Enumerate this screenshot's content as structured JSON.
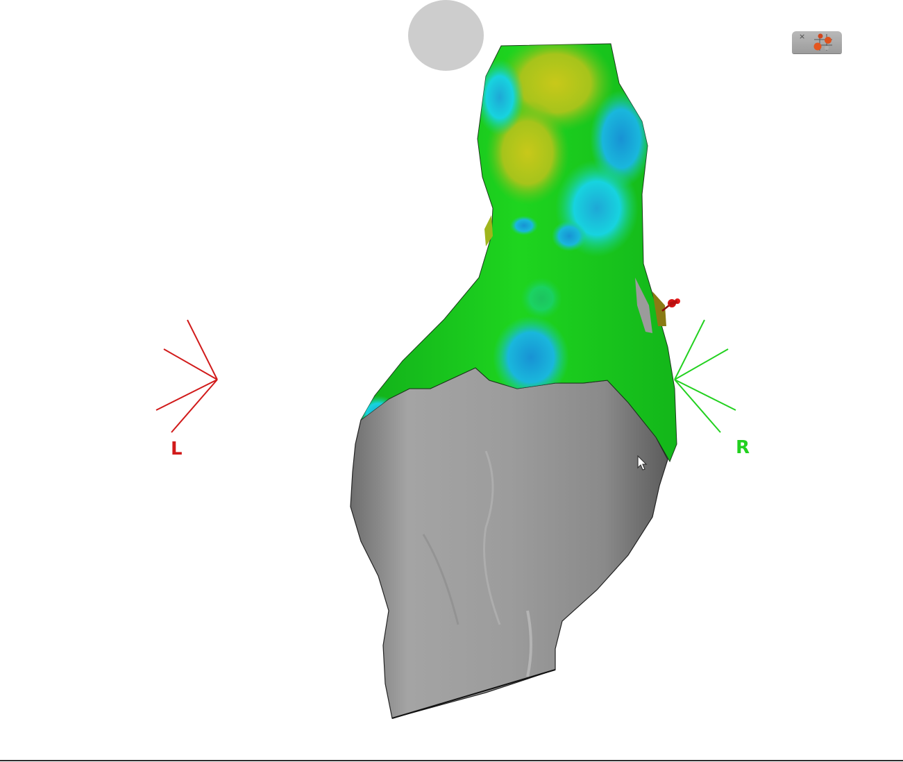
{
  "viewer": {
    "orientation": {
      "left_label": "L",
      "right_label": "R",
      "left_color": "#d11a1a",
      "right_color": "#22d11f"
    },
    "widget": {
      "close_glyph": "×",
      "icon": "map-layout-icon"
    },
    "model": {
      "map_colors": [
        "#c9c81a",
        "#17c91a",
        "#18b8d8",
        "#1fa0d6",
        "#9a9a9a"
      ],
      "marker": "pin-icon"
    }
  }
}
